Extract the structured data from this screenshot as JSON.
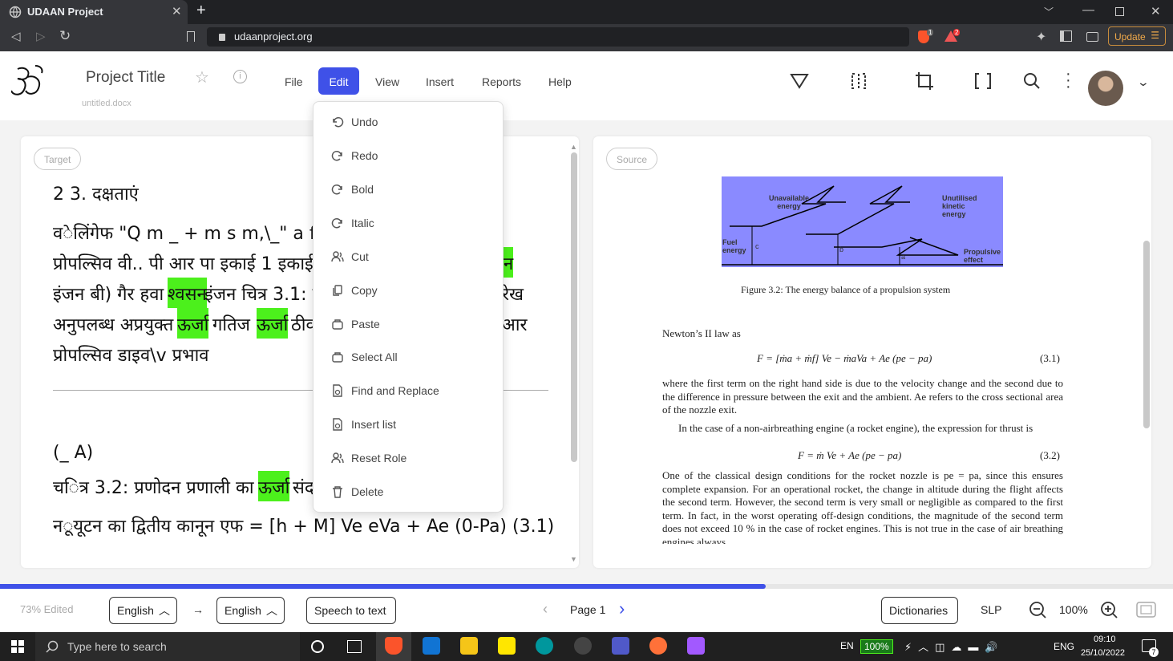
{
  "browser": {
    "tab_title": "UDAAN Project",
    "url": "udaanproject.org",
    "update_label": "Update",
    "badge_shield": "1",
    "badge_alert": "2"
  },
  "app": {
    "project_title": "Project Title",
    "file_name": "untitled.docx",
    "menu": [
      "File",
      "Edit",
      "View",
      "Insert",
      "Reports",
      "Help"
    ],
    "active_menu": "Edit"
  },
  "edit_menu": [
    "Undo",
    "Redo",
    "Bold",
    "Italic",
    "Cut",
    "Copy",
    "Paste",
    "Select All",
    "Find and Replace",
    "Insert list",
    "Reset Role",
    "Delete"
  ],
  "target": {
    "label": "Target",
    "lines": [
      "2 3. दक्षताएं",
      "व◌ेलिंगेफ \"Q m _ + m s m,\\_\" a f",
      "प्रोपल्सिव वी.. पी आर पा इकाई 1 इकाई",
      "इंजन बी) गैर हवा",
      "इंजन चित्र 3.1: प्र",
      "अनुपलब्ध अप्रयुक्त",
      "गतिज",
      "ठीव",
      "प्रोपल्सिव डाइव\\v प्रभाव",
      "(_ A)",
      "च◌ित्र 3.2: प्रणोदन प्रणाली का",
      "संद",
      "न◌ूयूटन का द्वितीय कानून एफ = [h + M] Ve eVa + Ae (0-Pa) (3.1)"
    ],
    "highlight_words": [
      "श्वसन",
      "ऊर्जा",
      "ऊर्जा",
      "ऊर्जा",
      "न"
    ],
    "right_fragments": [
      "रेख",
      "आर"
    ]
  },
  "source": {
    "label": "Source",
    "figure_labels": [
      "Unavailable energy",
      "Unutilised kinetic energy",
      "Fuel energy",
      "Propulsive effect",
      "c",
      "b",
      "a"
    ],
    "figure_caption": "Figure 3.2: The energy balance of a propulsion system",
    "intro": "Newton’s II law as",
    "eq1": "F = [ṁa + ṁf] Ve − ṁaVa + Ae (pe − pa)",
    "eq1_num": "(3.1)",
    "para1": "where the first term on the right hand side is due to the velocity change and the second due to the difference in pressure between the exit and the ambient. Ae refers to the cross sectional area of the nozzle exit.",
    "para2": "In the case of a non-airbreathing engine (a rocket engine), the expression for thrust is",
    "eq2": "F = ṁ Ve + Ae (pe − pa)",
    "eq2_num": "(3.2)",
    "para3": "One of the classical design conditions for the rocket nozzle is pe = pa, since this ensures complete expansion. For an operational rocket, the change in altitude during the flight affects the second term. However, the second term is very small or negligible as compared to the first term. In fact, in the worst operating off-design conditions, the magnitude of the second term does not exceed 10 % in the case of rocket engines. This is not true in the case of air breathing engines always."
  },
  "footer": {
    "edited": "73% Edited",
    "progress": 0.653,
    "lang_from": "English",
    "lang_to": "English",
    "speech_btn": "Speech to text",
    "page_label": "Page 1",
    "dictionaries": "Dictionaries",
    "slp": "SLP",
    "zoom": "100%"
  },
  "taskbar": {
    "search_placeholder": "Type here to search",
    "lang": "EN",
    "battery": "100%",
    "kbd": "ENG",
    "time": "09:10",
    "date": "25/10/2022",
    "notif_count": "7"
  }
}
